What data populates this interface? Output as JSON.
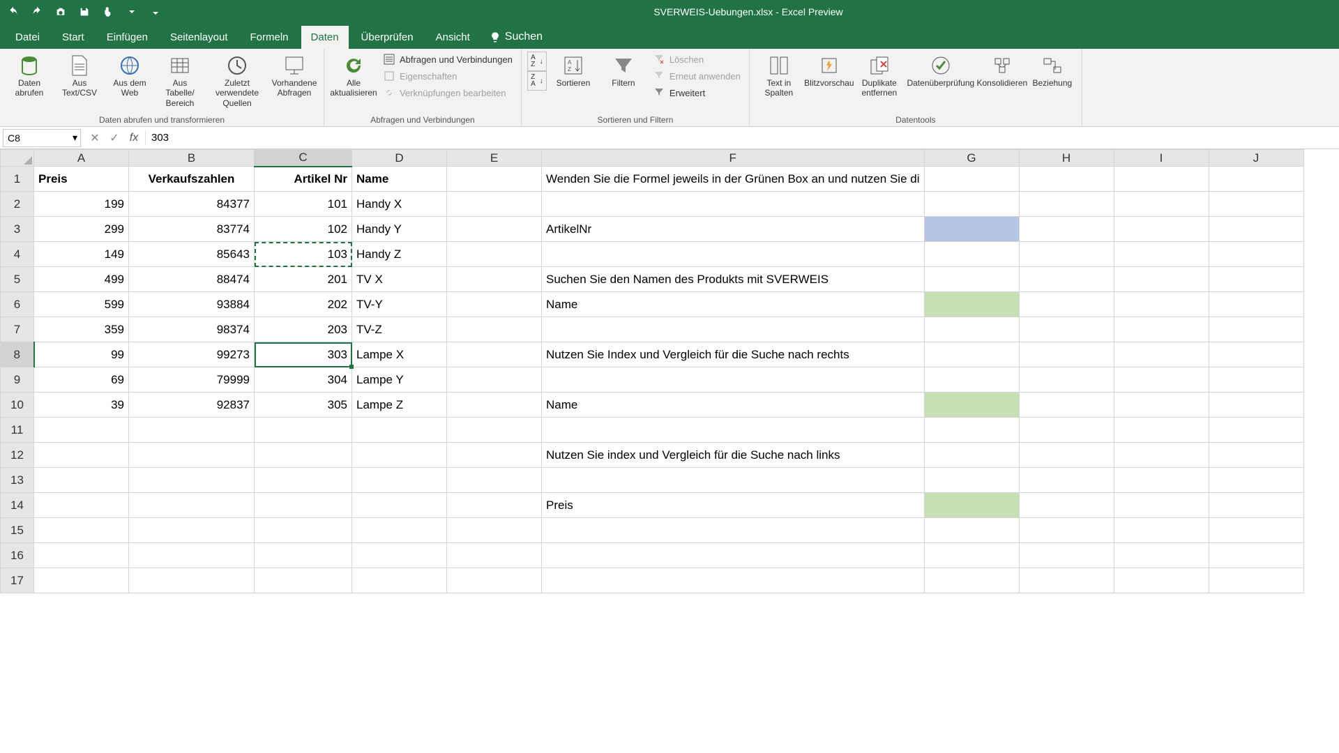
{
  "app": {
    "title": "SVERWEIS-Uebungen.xlsx - Excel Preview"
  },
  "qat": {
    "undo": "Undo",
    "redo": "Redo",
    "camera": "Camera",
    "save": "Save",
    "touch": "Touch",
    "customize": "Customize"
  },
  "tabs": {
    "datei": "Datei",
    "start": "Start",
    "einfuegen": "Einfügen",
    "seitenlayout": "Seitenlayout",
    "formeln": "Formeln",
    "daten": "Daten",
    "ueberpruefen": "Überprüfen",
    "ansicht": "Ansicht",
    "tellme_placeholder": "Suchen"
  },
  "ribbon": {
    "gettransform": {
      "title": "Daten abrufen und transformieren",
      "getdata": "Daten abrufen",
      "csv": "Aus Text/CSV",
      "web": "Aus dem Web",
      "table": "Aus Tabelle/ Bereich",
      "recent": "Zuletzt verwendete Quellen",
      "existing": "Vorhandene Abfragen"
    },
    "connections": {
      "title": "Abfragen und Verbindungen",
      "refresh": "Alle aktualisieren",
      "queries": "Abfragen und Verbindungen",
      "properties": "Eigenschaften",
      "editlinks": "Verknüpfungen bearbeiten"
    },
    "sortfilter": {
      "title": "Sortieren und Filtern",
      "sort_az": "A→Z",
      "sort_za": "Z→A",
      "sort": "Sortieren",
      "filter": "Filtern",
      "clear": "Löschen",
      "reapply": "Erneut anwenden",
      "advanced": "Erweitert"
    },
    "datatools": {
      "title": "Datentools",
      "t2c": "Text in Spalten",
      "flash": "Blitzvorschau",
      "dedup": "Duplikate entfernen",
      "validation": "Datenüberprüfung",
      "consolidate": "Konsolidieren",
      "relations": "Beziehung"
    }
  },
  "fbar": {
    "namebox": "C8",
    "formula": "303"
  },
  "cols": [
    "A",
    "B",
    "C",
    "D",
    "E",
    "F",
    "G",
    "H",
    "I",
    "J"
  ],
  "rows": [
    {
      "n": "1",
      "A": "Preis",
      "B": "Verkaufszahlen",
      "C": "Artikel Nr",
      "D": "Name",
      "F": "Wenden Sie die Formel jeweils in der Grünen Box an und nutzen Sie di"
    },
    {
      "n": "2",
      "A": "199",
      "B": "84377",
      "C": "101",
      "D": "Handy X"
    },
    {
      "n": "3",
      "A": "299",
      "B": "83774",
      "C": "102",
      "D": "Handy Y",
      "F": "ArtikelNr"
    },
    {
      "n": "4",
      "A": "149",
      "B": "85643",
      "C": "103",
      "D": "Handy Z"
    },
    {
      "n": "5",
      "A": "499",
      "B": "88474",
      "C": "201",
      "D": "TV X",
      "F": "Suchen Sie den Namen des Produkts mit SVERWEIS"
    },
    {
      "n": "6",
      "A": "599",
      "B": "93884",
      "C": "202",
      "D": "TV-Y",
      "F": "Name"
    },
    {
      "n": "7",
      "A": "359",
      "B": "98374",
      "C": "203",
      "D": "TV-Z"
    },
    {
      "n": "8",
      "A": "99",
      "B": "99273",
      "C": "303",
      "D": "Lampe X",
      "F": "Nutzen Sie Index und Vergleich für die Suche nach rechts"
    },
    {
      "n": "9",
      "A": "69",
      "B": "79999",
      "C": "304",
      "D": "Lampe Y"
    },
    {
      "n": "10",
      "A": "39",
      "B": "92837",
      "C": "305",
      "D": "Lampe Z",
      "F": "Name"
    },
    {
      "n": "11"
    },
    {
      "n": "12",
      "F": "Nutzen Sie index und Vergleich für die Suche nach links"
    },
    {
      "n": "13"
    },
    {
      "n": "14",
      "F": "Preis"
    },
    {
      "n": "15"
    },
    {
      "n": "16"
    },
    {
      "n": "17"
    }
  ],
  "iconGlyphs": {
    "dropdown": "▾",
    "fx": "fx",
    "cancel": "✕",
    "enter": "✓"
  }
}
